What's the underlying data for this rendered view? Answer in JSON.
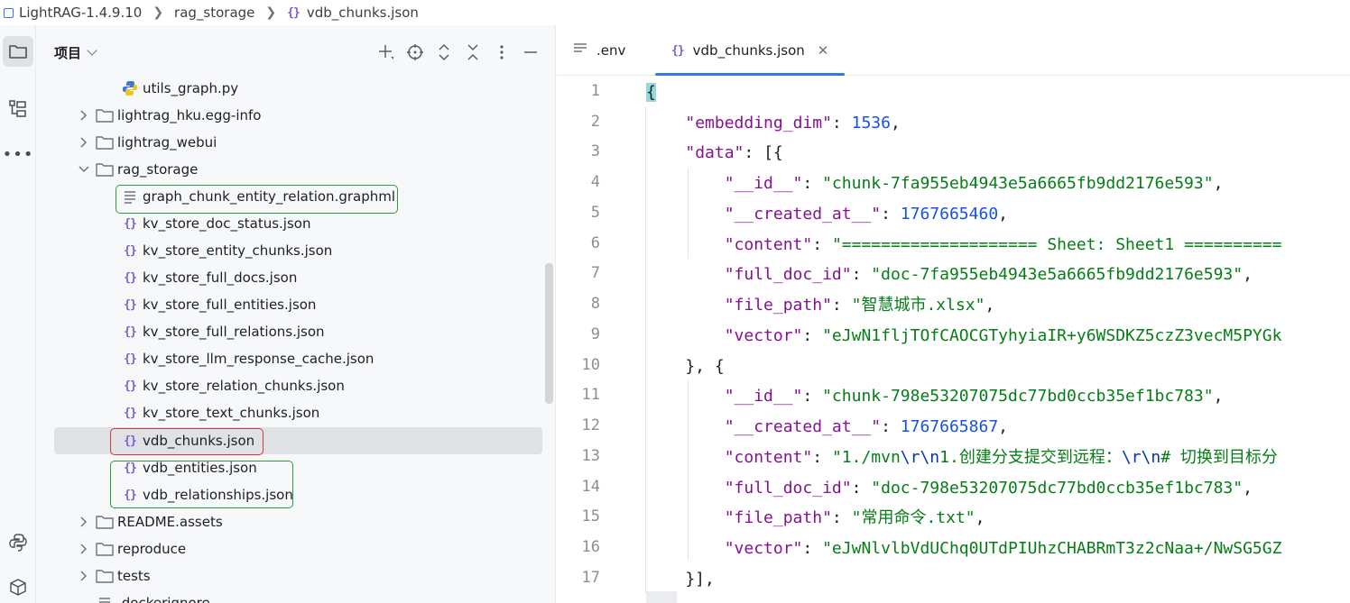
{
  "breadcrumb": {
    "project": "LightRAG-1.4.9.10",
    "folder": "rag_storage",
    "file": "vdb_chunks.json"
  },
  "project_panel": {
    "title": "项目"
  },
  "tree": [
    {
      "label": "utils_graph.py",
      "type": "python"
    },
    {
      "label": "lightrag_hku.egg-info",
      "type": "folder"
    },
    {
      "label": "lightrag_webui",
      "type": "folder"
    },
    {
      "label": "rag_storage",
      "type": "folder-open"
    },
    {
      "label": "graph_chunk_entity_relation.graphml",
      "type": "text"
    },
    {
      "label": "kv_store_doc_status.json",
      "type": "json"
    },
    {
      "label": "kv_store_entity_chunks.json",
      "type": "json"
    },
    {
      "label": "kv_store_full_docs.json",
      "type": "json"
    },
    {
      "label": "kv_store_full_entities.json",
      "type": "json"
    },
    {
      "label": "kv_store_full_relations.json",
      "type": "json"
    },
    {
      "label": "kv_store_llm_response_cache.json",
      "type": "json"
    },
    {
      "label": "kv_store_relation_chunks.json",
      "type": "json"
    },
    {
      "label": "kv_store_text_chunks.json",
      "type": "json"
    },
    {
      "label": "vdb_chunks.json",
      "type": "json"
    },
    {
      "label": "vdb_entities.json",
      "type": "json"
    },
    {
      "label": "vdb_relationships.json",
      "type": "json"
    },
    {
      "label": "README.assets",
      "type": "folder"
    },
    {
      "label": "reproduce",
      "type": "folder"
    },
    {
      "label": "tests",
      "type": "folder"
    },
    {
      "label": ".dockerignore",
      "type": "text"
    }
  ],
  "tabs": [
    {
      "label": ".env"
    },
    {
      "label": "vdb_chunks.json"
    }
  ],
  "code": {
    "line_numbers": [
      "1",
      "2",
      "3",
      "4",
      "5",
      "6",
      "7",
      "8",
      "9",
      "10",
      "11",
      "12",
      "13",
      "14",
      "15",
      "16",
      "17"
    ],
    "l2_key": "\"embedding_dim\"",
    "l2_val": "1536",
    "l3_key": "\"data\"",
    "l4_key": "\"__id__\"",
    "l4_val": "\"chunk-7fa955eb4943e5a6665fb9dd2176e593\"",
    "l5_key": "\"__created_at__\"",
    "l5_val": "1767665460",
    "l6_key": "\"content\"",
    "l6_val": "\"==================== Sheet: Sheet1 ==========",
    "l7_key": "\"full_doc_id\"",
    "l7_val": "\"doc-7fa955eb4943e5a6665fb9dd2176e593\"",
    "l8_key": "\"file_path\"",
    "l8_val": "\"智慧城市.xlsx\"",
    "l9_key": "\"vector\"",
    "l9_val": "\"eJwN1fljTOfCAOCGTyhyiaIR+y6WSDKZ5czZ3vecM5PYGk",
    "l11_key": "\"__id__\"",
    "l11_val": "\"chunk-798e53207075dc77bd0ccb35ef1bc783\"",
    "l12_key": "\"__created_at__\"",
    "l12_val": "1767665867",
    "l13_key": "\"content\"",
    "l13_a": "\"1./mvn",
    "l13_esc1": "\\r\\n",
    "l13_b": "1.创建分支提交到远程：",
    "l13_esc2": "\\r\\n",
    "l13_c": "# 切换到目标分",
    "l14_key": "\"full_doc_id\"",
    "l14_val": "\"doc-798e53207075dc77bd0ccb35ef1bc783\"",
    "l15_key": "\"file_path\"",
    "l15_val": "\"常用命令.txt\"",
    "l16_key": "\"vector\"",
    "l16_val": "\"eJwNlvlbVdUChq0UTdPIUhzCHABRmT3z2cNaa+/NwSG5GZ"
  }
}
